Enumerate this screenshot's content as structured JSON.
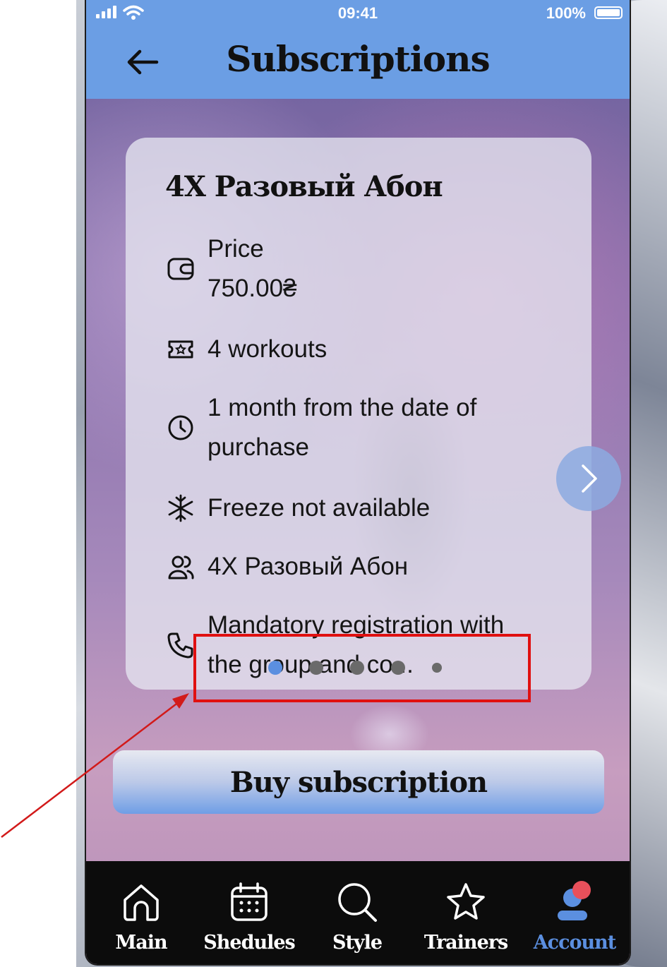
{
  "status_bar": {
    "time": "09:41",
    "battery": "100%"
  },
  "header": {
    "title": "Subscriptions"
  },
  "card": {
    "title": "4X Разовый Абон",
    "price_label": "Price",
    "price_value": "750.00₴",
    "workouts": "4 workouts",
    "validity": "1 month from the date of purchase",
    "freeze": "Freeze not available",
    "group": "4X Разовый Абон",
    "registration": "Mandatory registration with the group and co..."
  },
  "pager": {
    "count": 5,
    "active_index": 0
  },
  "buy_button": {
    "label": "Buy subscription"
  },
  "tabbar": {
    "tabs": [
      {
        "label": "Main",
        "icon": "home-icon"
      },
      {
        "label": "Shedules",
        "icon": "calendar-icon"
      },
      {
        "label": "Style",
        "icon": "search-icon"
      },
      {
        "label": "Trainers",
        "icon": "star-icon"
      },
      {
        "label": "Account",
        "icon": "account-icon",
        "active": true
      }
    ]
  },
  "colors": {
    "header_bg": "#6b9ee4",
    "accent": "#5b8fe0",
    "annotation": "#e01010",
    "tabbar_bg": "#0c0c0c",
    "notification_dot": "#e8505b"
  }
}
